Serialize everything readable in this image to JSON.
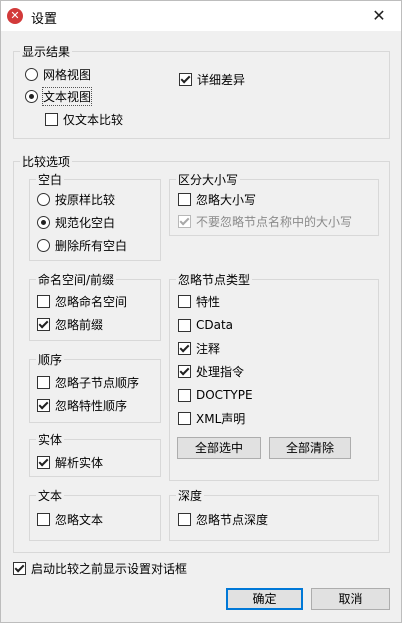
{
  "window": {
    "title": "设置",
    "app_icon": "x-logo-icon",
    "close_label": "✕"
  },
  "display_results": {
    "title": "显示结果",
    "grid_view": "网格视图",
    "text_view": "文本视图",
    "text_compare_only": "仅文本比较",
    "detailed_diff": "详细差异"
  },
  "compare_options": {
    "title": "比较选项",
    "whitespace": {
      "title": "空白",
      "as_is": "按原样比较",
      "normalize": "规范化空白",
      "strip_all": "删除所有空白"
    },
    "case": {
      "title": "区分大小写",
      "ignore_case": "忽略大小写",
      "ignore_node_name_case": "不要忽略节点名称中的大小写"
    },
    "namespace": {
      "title": "命名空间/前缀",
      "ignore_namespace": "忽略命名空间",
      "ignore_prefix": "忽略前缀"
    },
    "order": {
      "title": "顺序",
      "ignore_child_order": "忽略子节点顺序",
      "ignore_attr_order": "忽略特性顺序"
    },
    "entities": {
      "title": "实体",
      "resolve_entities": "解析实体"
    },
    "text": {
      "title": "文本",
      "ignore_text": "忽略文本"
    },
    "ignore_node_types": {
      "title": "忽略节点类型",
      "items": [
        "特性",
        "CData",
        "注释",
        "处理指令",
        "DOCTYPE",
        "XML声明"
      ],
      "select_all": "全部选中",
      "clear_all": "全部清除"
    },
    "depth": {
      "title": "深度",
      "ignore_node_depth": "忽略节点深度"
    }
  },
  "show_before_compare": "启动比较之前显示设置对话框",
  "ok_label": "确定",
  "cancel_label": "取消"
}
